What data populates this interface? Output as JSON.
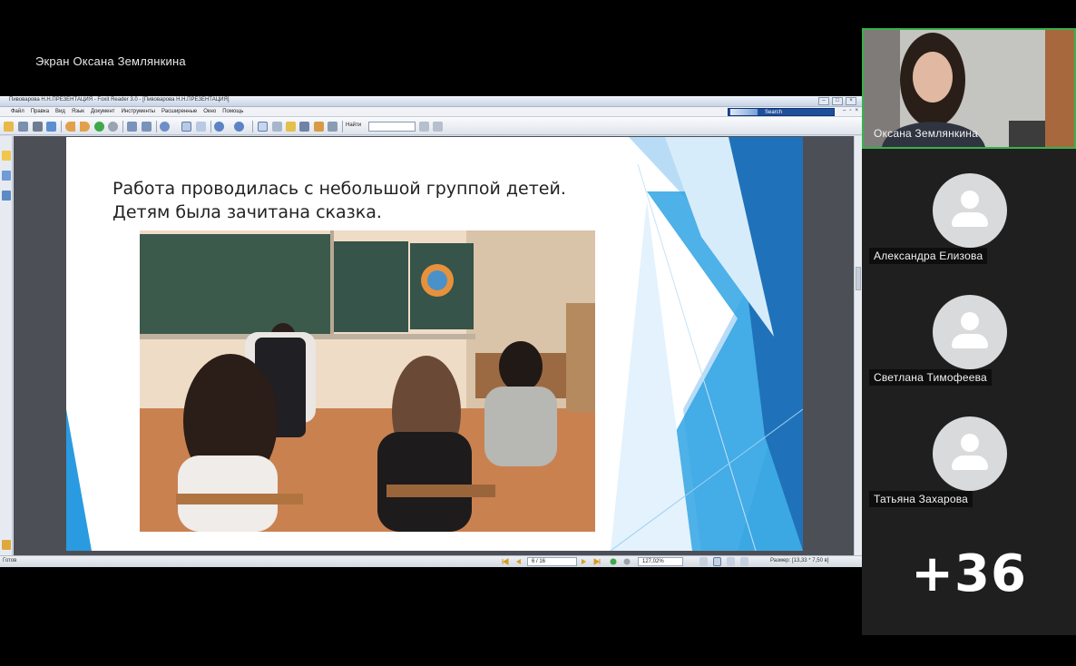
{
  "meeting": {
    "screen_share_label": "Экран Оксана Землянкина",
    "more_participants": "+36"
  },
  "app": {
    "title": "Пивоварова Н.Н.ПРЕЗЕНТАЦИЯ - Foxit Reader 3.0 - [Пивоварова Н.Н.ПРЕЗЕНТАЦИЯ]",
    "menu": [
      "Файл",
      "Правка",
      "Вид",
      "Язык",
      "Документ",
      "Инструменты",
      "Расширенные",
      "Окно",
      "Помощь"
    ],
    "search_label": "Search",
    "find_label": "Найти",
    "find_value": "",
    "status_ready": "Готов",
    "page_indicator": "6 / 16",
    "zoom": "127,02%",
    "page_size": "Размер: [13,33 * 7,50 в]"
  },
  "slide": {
    "text": "Работа проводилась с небольшой группой детей. Детям была зачитана сказка."
  },
  "participants": [
    {
      "name": "Оксана Землянкина",
      "video": true
    },
    {
      "name": "Александра Елизова",
      "video": false
    },
    {
      "name": "Светлана Тимофеева",
      "video": false
    },
    {
      "name": "Татьяна Захарова",
      "video": false
    }
  ],
  "colors": {
    "active_speaker_border": "#37b24d",
    "slide_accent": "#1f8fd6"
  }
}
